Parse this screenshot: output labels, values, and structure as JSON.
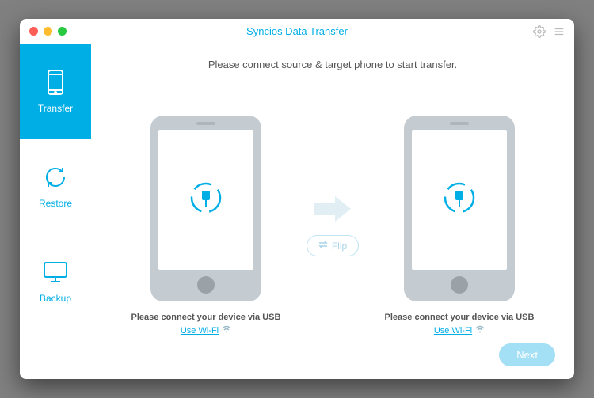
{
  "header": {
    "title": "Syncios Data Transfer"
  },
  "sidebar": {
    "items": [
      {
        "label": "Transfer",
        "active": true
      },
      {
        "label": "Restore",
        "active": false
      },
      {
        "label": "Backup",
        "active": false
      }
    ]
  },
  "main": {
    "instruction": "Please connect source & target phone to start transfer.",
    "flip_label": "Flip",
    "next_label": "Next",
    "source": {
      "status": "Please connect your device via USB",
      "wifi_link": "Use Wi-Fi"
    },
    "target": {
      "status": "Please connect your device via USB",
      "wifi_link": "Use Wi-Fi"
    }
  },
  "colors": {
    "accent": "#00aee6"
  }
}
